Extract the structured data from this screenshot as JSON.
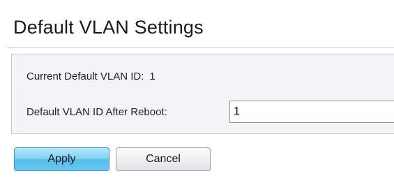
{
  "section": {
    "title": "Default VLAN Settings"
  },
  "current_vlan": {
    "label": "Current Default VLAN ID:",
    "value": "1"
  },
  "after_reboot": {
    "label": "Default VLAN ID After Reboot:",
    "value": "1"
  },
  "buttons": {
    "apply": "Apply",
    "cancel": "Cancel"
  },
  "colors": {
    "apply_button": "#6cc7ef",
    "panel_background": "#f2f4f7"
  }
}
